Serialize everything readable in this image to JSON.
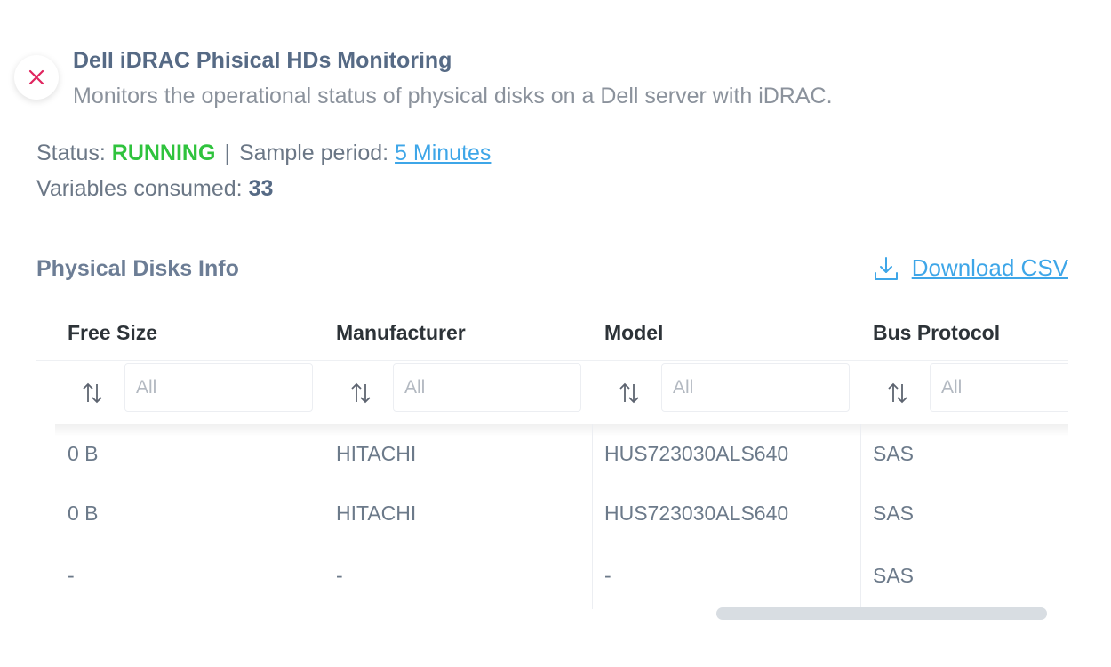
{
  "header": {
    "title": "Dell iDRAC Phisical HDs Monitoring",
    "subtitle": "Monitors the operational status of physical disks on a Dell server with iDRAC."
  },
  "status": {
    "label": "Status: ",
    "value": "RUNNING",
    "separator": "|",
    "sample_label": "Sample period: ",
    "sample_value": "5 Minutes",
    "variables_label": "Variables consumed: ",
    "variables_value": "33"
  },
  "section": {
    "title": "Physical Disks Info",
    "download_label": "Download CSV"
  },
  "table": {
    "columns": [
      "Free Size",
      "Manufacturer",
      "Model",
      "Bus Protocol"
    ],
    "filter_placeholder": "All",
    "rows": [
      [
        "0 B",
        "HITACHI",
        "HUS723030ALS640",
        "SAS"
      ],
      [
        "0 B",
        "HITACHI",
        "HUS723030ALS640",
        "SAS"
      ],
      [
        "-",
        "-",
        "-",
        "SAS"
      ]
    ]
  },
  "colors": {
    "status_running": "#2fc33d",
    "link": "#3ea6e8",
    "close_icon": "#e0245e",
    "title": "#566a85"
  },
  "icons": {
    "close": "close-icon",
    "download": "download-icon",
    "sort": "sort-icon"
  }
}
